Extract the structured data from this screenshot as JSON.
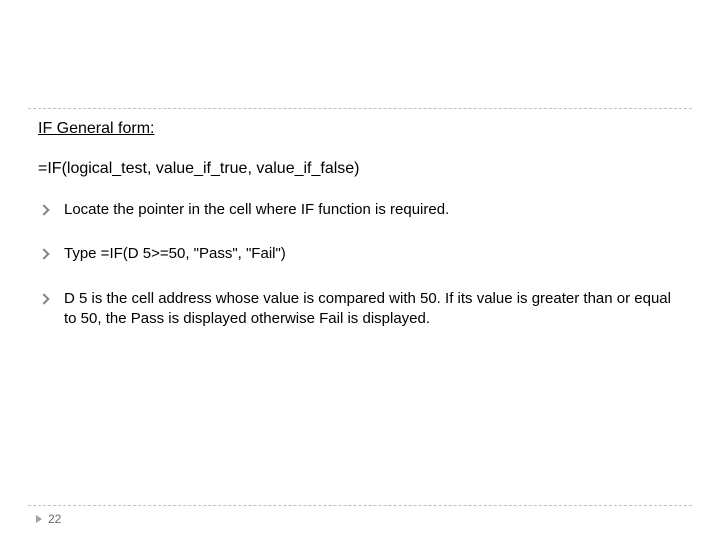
{
  "heading": "IF General form:",
  "syntax": "=IF(logical_test, value_if_true, value_if_false)",
  "bullets": [
    "Locate the pointer in the cell where IF function is required.",
    "Type =IF(D 5>=50, \"Pass\", \"Fail\")",
    "D 5 is the cell address whose value is compared with 50. If its value is greater than or equal to 50, the Pass is displayed otherwise Fail is displayed."
  ],
  "page_number": "22"
}
